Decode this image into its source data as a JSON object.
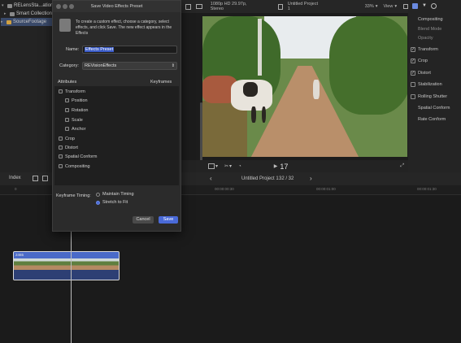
{
  "library": {
    "items": [
      {
        "label": "RELensSta...ation c",
        "expand": "▾"
      },
      {
        "label": "Smart Collections",
        "expand": "▸"
      },
      {
        "label": "SourceFootage",
        "expand": "▸"
      }
    ]
  },
  "viewer": {
    "format": "1080p HD 29.97p, Stereo",
    "project_title": "Untitled Project 1",
    "zoom": "33%",
    "view_menu": "View",
    "timecode": "17"
  },
  "inspector": {
    "items": [
      {
        "label": "Compositing",
        "checked": null
      },
      {
        "label": "Blend Mode",
        "checked": null
      },
      {
        "label": "Opacity",
        "checked": null
      },
      {
        "label": "Transform",
        "checked": true
      },
      {
        "label": "Crop",
        "checked": true
      },
      {
        "label": "Distort",
        "checked": true
      },
      {
        "label": "Stabilization",
        "checked": false
      },
      {
        "label": "Rolling Shutter",
        "checked": false
      },
      {
        "label": "Spatial Conform",
        "checked": null
      },
      {
        "label": "Rate Conform",
        "checked": null
      }
    ]
  },
  "timeline": {
    "index_label": "Index",
    "project_title": "Untitled Project 1",
    "count": "32 / 32",
    "ruler_ticks": [
      "0",
      "00:00:00:30",
      "00:00:01:00",
      "00:00:01:30"
    ]
  },
  "dialog": {
    "title": "Save Video Effects Preset",
    "description": "To create a custom effect, choose a category, select effects, and click Save. The new effect appears in the Effects",
    "name_label": "Name:",
    "name_value": "Effects Preset",
    "category_label": "Category:",
    "category_value": "REVisionEffects",
    "attributes_header": "Attributes",
    "keyframes_header": "Keyframes",
    "attributes": [
      {
        "label": "Transform",
        "indent": 0
      },
      {
        "label": "Position",
        "indent": 1
      },
      {
        "label": "Rotation",
        "indent": 1
      },
      {
        "label": "Scale",
        "indent": 1
      },
      {
        "label": "Anchor",
        "indent": 1
      },
      {
        "label": "Crop",
        "indent": 0
      },
      {
        "label": "Distort",
        "indent": 0
      },
      {
        "label": "Spatial Conform",
        "indent": 0
      },
      {
        "label": "Compositing",
        "indent": 0
      }
    ],
    "keyframe_timing_label": "Keyframe Timing:",
    "timing_options": [
      {
        "label": "Maintain Timing",
        "selected": false
      },
      {
        "label": "Stretch to Fit",
        "selected": true
      }
    ],
    "cancel_label": "Cancel",
    "save_label": "Save"
  },
  "clip": {
    "label": "2465"
  },
  "colors": {
    "accent": "#4a6ad8",
    "clip_blue": "#4a6ac8",
    "selection": "#3a4a6a"
  }
}
